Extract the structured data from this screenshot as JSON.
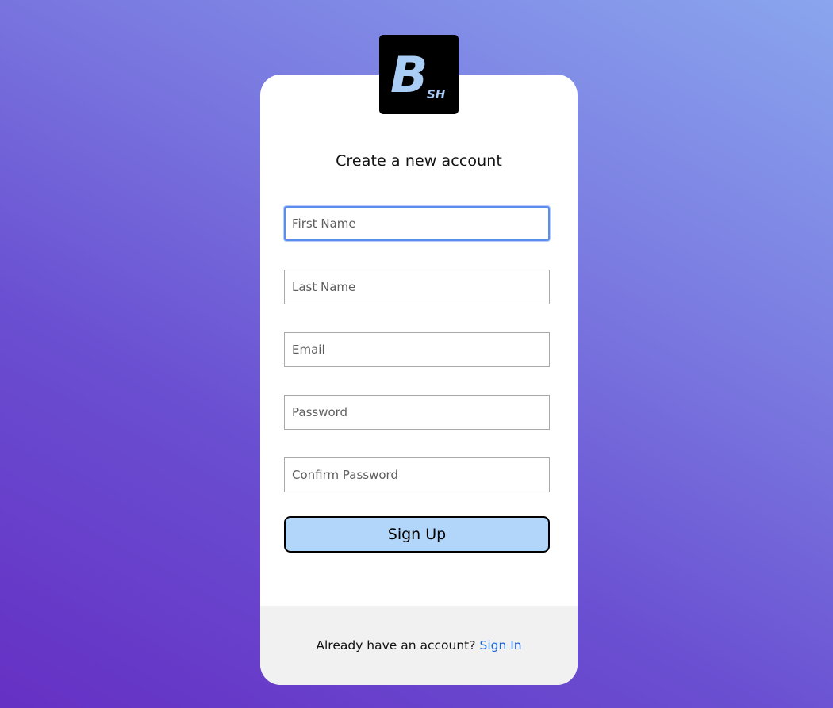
{
  "logo": {
    "main_letter": "B",
    "sub_letters": "SH",
    "background": "#000000",
    "letter_color": "#a9cdf5"
  },
  "form": {
    "title": "Create a new account",
    "first_name": {
      "placeholder": "First Name",
      "value": ""
    },
    "last_name": {
      "placeholder": "Last Name",
      "value": ""
    },
    "email": {
      "placeholder": "Email",
      "value": ""
    },
    "password": {
      "placeholder": "Password",
      "value": ""
    },
    "confirm_password": {
      "placeholder": "Confirm Password",
      "value": ""
    },
    "submit_label": "Sign Up"
  },
  "footer": {
    "prompt": "Already have an account?",
    "link_label": "Sign In"
  },
  "colors": {
    "background_gradient": [
      "#6530c4",
      "#8aa6ee"
    ],
    "button": "#b1d6f9",
    "link": "#1a66d9",
    "focus_ring": "#5b8def"
  }
}
